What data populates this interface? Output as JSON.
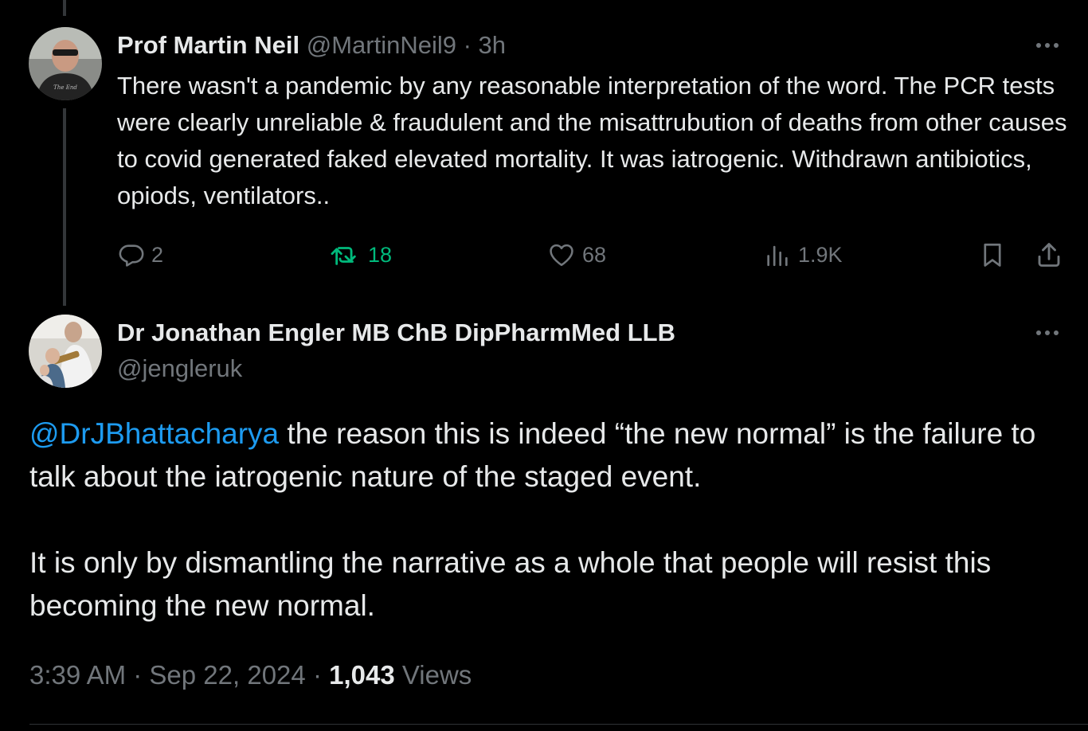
{
  "colors": {
    "background": "#000000",
    "text": "#e7e9ea",
    "muted": "#71767b",
    "accent_link": "#1d9bf0",
    "repost_active": "#00ba7c",
    "divider": "#2f3336"
  },
  "reply_tweet": {
    "display_name": "Prof Martin Neil",
    "handle": "@MartinNeil9",
    "separator": "·",
    "time": "3h",
    "text": "There wasn't a pandemic by any reasonable interpretation of the word. The PCR tests were clearly unreliable & fraudulent and the misattrubution of deaths from other causes to covid generated faked elevated mortality. It was iatrogenic. Withdrawn antibiotics, opiods, ventilators..",
    "actions": {
      "replies": "2",
      "reposts": "18",
      "likes": "68",
      "views": "1.9K"
    },
    "icons": [
      "reply-icon",
      "repost-icon",
      "like-icon",
      "views-icon",
      "bookmark-icon",
      "share-icon",
      "more-icon"
    ]
  },
  "main_tweet": {
    "display_name": "Dr Jonathan Engler MB ChB DipPharmMed LLB",
    "handle": "@jengleruk",
    "mention": "@DrJBhattacharya",
    "text_after_mention": " the reason this is indeed “the new normal” is the failure to talk about the iatrogenic nature of the staged event.",
    "paragraph2": "It is only by dismantling the narrative as a whole that people will resist this becoming the new normal.",
    "time": "3:39 AM",
    "date": "Sep 22, 2024",
    "separator": "·",
    "views_count": "1,043",
    "views_label": "Views"
  }
}
